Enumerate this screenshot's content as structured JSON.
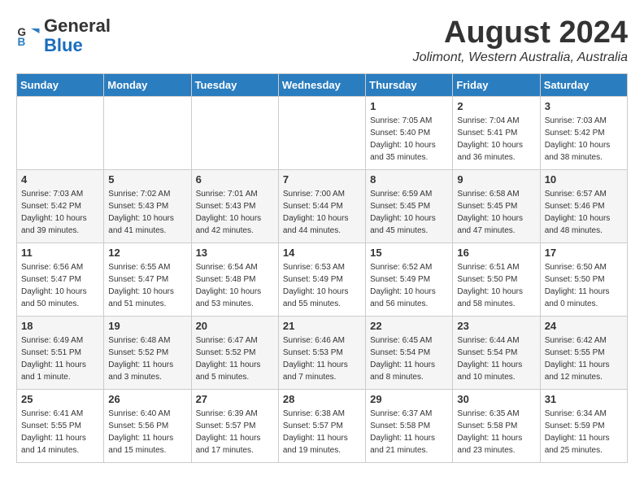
{
  "header": {
    "logo_general": "General",
    "logo_blue": "Blue",
    "month_year": "August 2024",
    "location": "Jolimont, Western Australia, Australia"
  },
  "days_of_week": [
    "Sunday",
    "Monday",
    "Tuesday",
    "Wednesday",
    "Thursday",
    "Friday",
    "Saturday"
  ],
  "weeks": [
    [
      {
        "day": "",
        "info": ""
      },
      {
        "day": "",
        "info": ""
      },
      {
        "day": "",
        "info": ""
      },
      {
        "day": "",
        "info": ""
      },
      {
        "day": "1",
        "info": "Sunrise: 7:05 AM\nSunset: 5:40 PM\nDaylight: 10 hours\nand 35 minutes."
      },
      {
        "day": "2",
        "info": "Sunrise: 7:04 AM\nSunset: 5:41 PM\nDaylight: 10 hours\nand 36 minutes."
      },
      {
        "day": "3",
        "info": "Sunrise: 7:03 AM\nSunset: 5:42 PM\nDaylight: 10 hours\nand 38 minutes."
      }
    ],
    [
      {
        "day": "4",
        "info": "Sunrise: 7:03 AM\nSunset: 5:42 PM\nDaylight: 10 hours\nand 39 minutes."
      },
      {
        "day": "5",
        "info": "Sunrise: 7:02 AM\nSunset: 5:43 PM\nDaylight: 10 hours\nand 41 minutes."
      },
      {
        "day": "6",
        "info": "Sunrise: 7:01 AM\nSunset: 5:43 PM\nDaylight: 10 hours\nand 42 minutes."
      },
      {
        "day": "7",
        "info": "Sunrise: 7:00 AM\nSunset: 5:44 PM\nDaylight: 10 hours\nand 44 minutes."
      },
      {
        "day": "8",
        "info": "Sunrise: 6:59 AM\nSunset: 5:45 PM\nDaylight: 10 hours\nand 45 minutes."
      },
      {
        "day": "9",
        "info": "Sunrise: 6:58 AM\nSunset: 5:45 PM\nDaylight: 10 hours\nand 47 minutes."
      },
      {
        "day": "10",
        "info": "Sunrise: 6:57 AM\nSunset: 5:46 PM\nDaylight: 10 hours\nand 48 minutes."
      }
    ],
    [
      {
        "day": "11",
        "info": "Sunrise: 6:56 AM\nSunset: 5:47 PM\nDaylight: 10 hours\nand 50 minutes."
      },
      {
        "day": "12",
        "info": "Sunrise: 6:55 AM\nSunset: 5:47 PM\nDaylight: 10 hours\nand 51 minutes."
      },
      {
        "day": "13",
        "info": "Sunrise: 6:54 AM\nSunset: 5:48 PM\nDaylight: 10 hours\nand 53 minutes."
      },
      {
        "day": "14",
        "info": "Sunrise: 6:53 AM\nSunset: 5:49 PM\nDaylight: 10 hours\nand 55 minutes."
      },
      {
        "day": "15",
        "info": "Sunrise: 6:52 AM\nSunset: 5:49 PM\nDaylight: 10 hours\nand 56 minutes."
      },
      {
        "day": "16",
        "info": "Sunrise: 6:51 AM\nSunset: 5:50 PM\nDaylight: 10 hours\nand 58 minutes."
      },
      {
        "day": "17",
        "info": "Sunrise: 6:50 AM\nSunset: 5:50 PM\nDaylight: 11 hours\nand 0 minutes."
      }
    ],
    [
      {
        "day": "18",
        "info": "Sunrise: 6:49 AM\nSunset: 5:51 PM\nDaylight: 11 hours\nand 1 minute."
      },
      {
        "day": "19",
        "info": "Sunrise: 6:48 AM\nSunset: 5:52 PM\nDaylight: 11 hours\nand 3 minutes."
      },
      {
        "day": "20",
        "info": "Sunrise: 6:47 AM\nSunset: 5:52 PM\nDaylight: 11 hours\nand 5 minutes."
      },
      {
        "day": "21",
        "info": "Sunrise: 6:46 AM\nSunset: 5:53 PM\nDaylight: 11 hours\nand 7 minutes."
      },
      {
        "day": "22",
        "info": "Sunrise: 6:45 AM\nSunset: 5:54 PM\nDaylight: 11 hours\nand 8 minutes."
      },
      {
        "day": "23",
        "info": "Sunrise: 6:44 AM\nSunset: 5:54 PM\nDaylight: 11 hours\nand 10 minutes."
      },
      {
        "day": "24",
        "info": "Sunrise: 6:42 AM\nSunset: 5:55 PM\nDaylight: 11 hours\nand 12 minutes."
      }
    ],
    [
      {
        "day": "25",
        "info": "Sunrise: 6:41 AM\nSunset: 5:55 PM\nDaylight: 11 hours\nand 14 minutes."
      },
      {
        "day": "26",
        "info": "Sunrise: 6:40 AM\nSunset: 5:56 PM\nDaylight: 11 hours\nand 15 minutes."
      },
      {
        "day": "27",
        "info": "Sunrise: 6:39 AM\nSunset: 5:57 PM\nDaylight: 11 hours\nand 17 minutes."
      },
      {
        "day": "28",
        "info": "Sunrise: 6:38 AM\nSunset: 5:57 PM\nDaylight: 11 hours\nand 19 minutes."
      },
      {
        "day": "29",
        "info": "Sunrise: 6:37 AM\nSunset: 5:58 PM\nDaylight: 11 hours\nand 21 minutes."
      },
      {
        "day": "30",
        "info": "Sunrise: 6:35 AM\nSunset: 5:58 PM\nDaylight: 11 hours\nand 23 minutes."
      },
      {
        "day": "31",
        "info": "Sunrise: 6:34 AM\nSunset: 5:59 PM\nDaylight: 11 hours\nand 25 minutes."
      }
    ]
  ]
}
